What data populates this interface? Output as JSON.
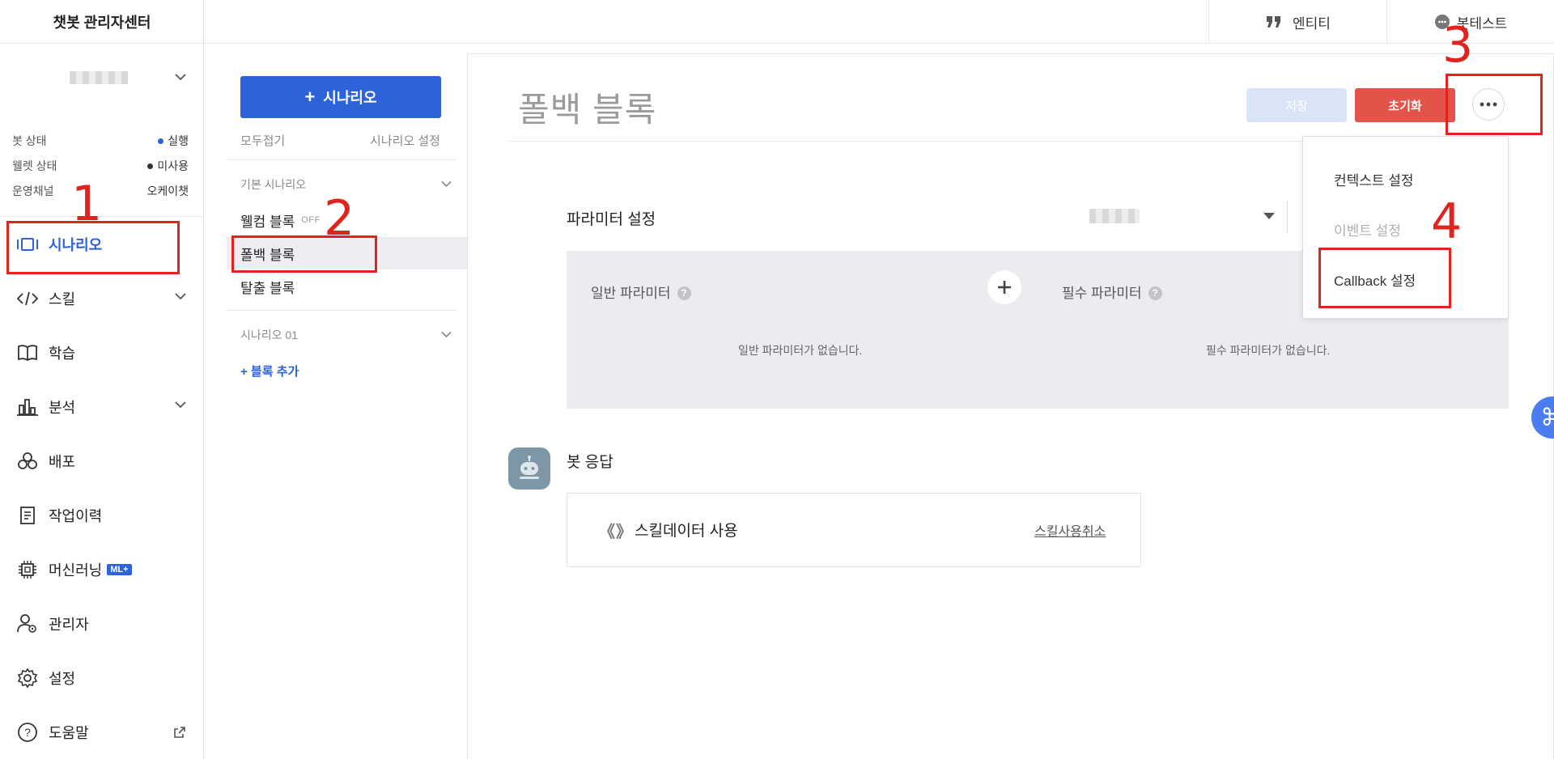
{
  "app": {
    "title": "챗봇 관리자센터"
  },
  "sidebar": {
    "status": [
      {
        "label": "봇 상태",
        "value": "실행",
        "dot_color": "#2d62d9"
      },
      {
        "label": "웰렛 상태",
        "value": "미사용",
        "dot_color": "#333333"
      },
      {
        "label": "운영채널",
        "value": "오케이챗"
      }
    ],
    "nav": [
      {
        "label": "시나리오",
        "icon": "scenario-icon",
        "active": true
      },
      {
        "label": "스킬",
        "icon": "code-icon",
        "has_chevron": true
      },
      {
        "label": "학습",
        "icon": "book-icon"
      },
      {
        "label": "분석",
        "icon": "bar-chart-icon",
        "has_chevron": true
      },
      {
        "label": "배포",
        "icon": "deploy-icon"
      },
      {
        "label": "작업이력",
        "icon": "history-icon"
      },
      {
        "label": "머신러닝",
        "icon": "chip-icon",
        "badge": "ML+"
      },
      {
        "label": "관리자",
        "icon": "admin-user-icon"
      },
      {
        "label": "설정",
        "icon": "gear-icon"
      },
      {
        "label": "도움말",
        "icon": "help-icon",
        "external": true
      }
    ]
  },
  "topbar": {
    "tabs": [
      {
        "label": "엔티티",
        "icon": "quote-icon"
      },
      {
        "label": "봇테스트",
        "icon": "chat-bot-icon"
      }
    ]
  },
  "scenario_panel": {
    "add_button": "시나리오",
    "collapse_all": "모두접기",
    "settings": "시나리오 설정",
    "groups": [
      {
        "title": "기본 시나리오",
        "items": [
          {
            "label": "웰컴 블록",
            "tag": "OFF"
          },
          {
            "label": "폴백 블록",
            "active": true
          },
          {
            "label": "탈출 블록"
          }
        ]
      },
      {
        "title": "시나리오 01",
        "add_block": "+ 블록 추가"
      }
    ]
  },
  "editor": {
    "block_title": "폴백 블록",
    "save": "저장",
    "reset": "초기화",
    "parameters": {
      "label": "파라미터 설정",
      "general_title": "일반 파라미터",
      "required_title": "필수 파라미터",
      "general_empty": "일반 파라미터가 없습니다.",
      "required_empty": "필수 파라미터가 없습니다."
    },
    "bot_reply": {
      "label": "봇 응답",
      "skill_braces": "《》",
      "skill_text": "스킬데이터 사용",
      "skill_cancel": "스킬사용취소"
    }
  },
  "dropdown": {
    "items": [
      {
        "label": "컨텍스트 설정"
      },
      {
        "label": "이벤트 설정",
        "disabled": true
      },
      {
        "label": "Callback 설정"
      }
    ]
  },
  "annotations": {
    "numbers": [
      "1",
      "2",
      "3",
      "4"
    ],
    "color": "#e0231c"
  },
  "colors": {
    "primary": "#2d62d9",
    "danger": "#e4534a",
    "save_disabled": "#d9e4f7",
    "panel_bg": "#ebebf0"
  }
}
